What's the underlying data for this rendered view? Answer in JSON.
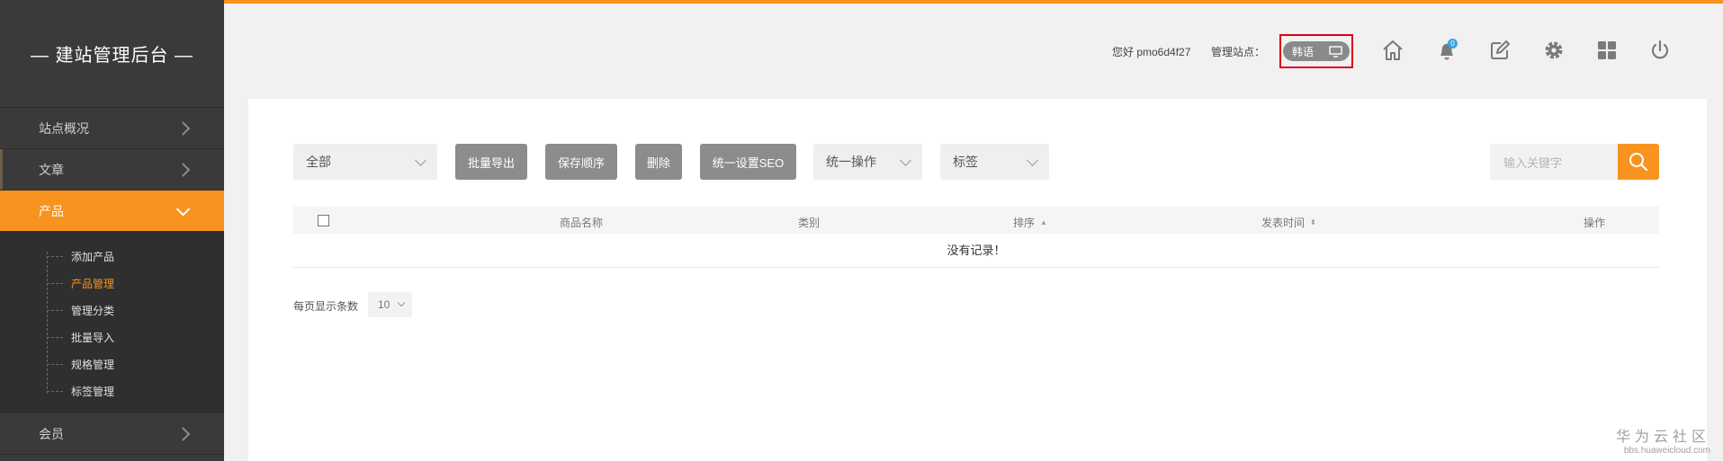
{
  "brand": {
    "title": "— 建站管理后台 —"
  },
  "sidebar": {
    "items": [
      {
        "label": "站点概况"
      },
      {
        "label": "文章"
      },
      {
        "label": "产品"
      },
      {
        "label": "会员"
      }
    ],
    "product_sub": [
      {
        "label": "添加产品"
      },
      {
        "label": "产品管理"
      },
      {
        "label": "管理分类"
      },
      {
        "label": "批量导入"
      },
      {
        "label": "规格管理"
      },
      {
        "label": "标签管理"
      }
    ]
  },
  "header": {
    "greeting": "您好 pmo6d4f27",
    "site_label": "管理站点：",
    "site_value": "韩语",
    "notification_count": "0",
    "icons": [
      "home-icon",
      "bell-icon",
      "edit-icon",
      "gear-icon",
      "grid-icon",
      "power-icon"
    ]
  },
  "toolbar": {
    "filter_all": "全部",
    "export_btn": "批量导出",
    "save_order_btn": "保存顺序",
    "delete_btn": "删除",
    "seo_btn": "统一设置SEO",
    "batch_ops": "统一操作",
    "tag_select": "标签",
    "search_placeholder": "输入关键字"
  },
  "table": {
    "columns": [
      "商品名称",
      "类别",
      "排序",
      "发表时间",
      "操作"
    ],
    "empty_text": "没有记录！"
  },
  "pager": {
    "label": "每页显示条数",
    "page_size": "10"
  },
  "watermark": {
    "line1": "华为云社区",
    "line2": "bbs.huaweicloud.com"
  },
  "colors": {
    "accent": "#f7931e",
    "sidebar_bg": "#3a3a3a",
    "highlight_border": "#d9001b",
    "button_gray": "#8c8c8c"
  }
}
